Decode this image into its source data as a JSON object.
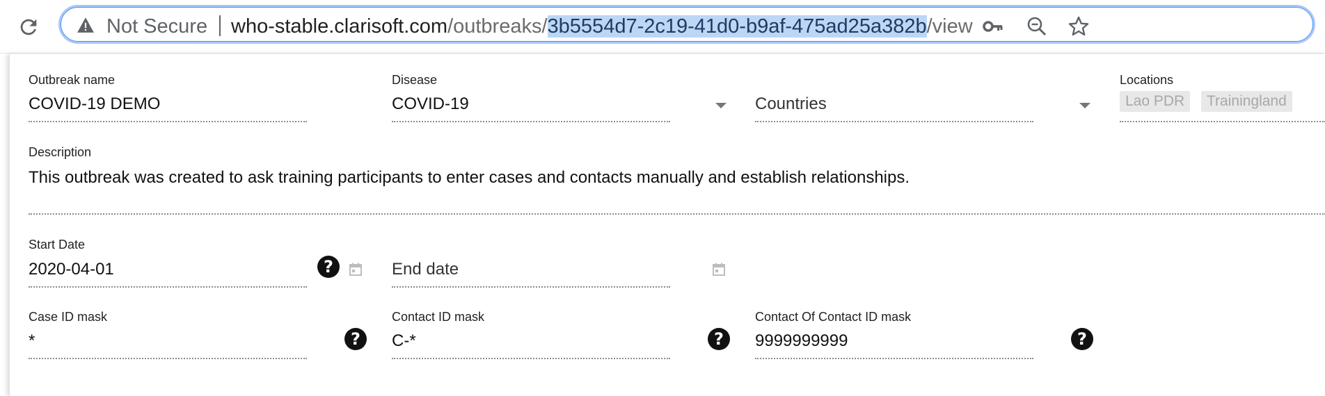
{
  "browser": {
    "security_label": "Not Secure",
    "url": {
      "host": "who-stable.clarisoft.com",
      "path_prefix": "/outbreaks/",
      "path_selected": "3b5554d7-2c19-41d0-b9af-475ad25a382b",
      "path_suffix": "/view"
    },
    "icons": [
      "reload-icon",
      "warning-icon",
      "key-icon",
      "zoom-out-icon",
      "star-icon"
    ]
  },
  "form": {
    "outbreak_name": {
      "label": "Outbreak name",
      "value": "COVID-19 DEMO"
    },
    "disease": {
      "label": "Disease",
      "value": "COVID-19"
    },
    "countries": {
      "placeholder": "Countries"
    },
    "locations": {
      "label": "Locations",
      "chips": [
        "Lao PDR",
        "Trainingland"
      ]
    },
    "description": {
      "label": "Description",
      "value": "This outbreak was created to ask training participants to enter cases and contacts manually and establish relationships."
    },
    "start_date": {
      "label": "Start Date",
      "value": "2020-04-01"
    },
    "end_date": {
      "placeholder": "End date"
    },
    "case_id_mask": {
      "label": "Case ID mask",
      "value": "*"
    },
    "contact_id_mask": {
      "label": "Contact ID mask",
      "value": "C-*"
    },
    "contact_of_contact_id_mask": {
      "label": "Contact Of Contact ID mask",
      "value": "9999999999"
    },
    "help_glyph": "?"
  },
  "colors": {
    "selection": "#bcd6f6",
    "focus_ring": "#a8c7fa",
    "chip_bg": "#e8e8e8",
    "chip_text": "#a8a8a8"
  }
}
